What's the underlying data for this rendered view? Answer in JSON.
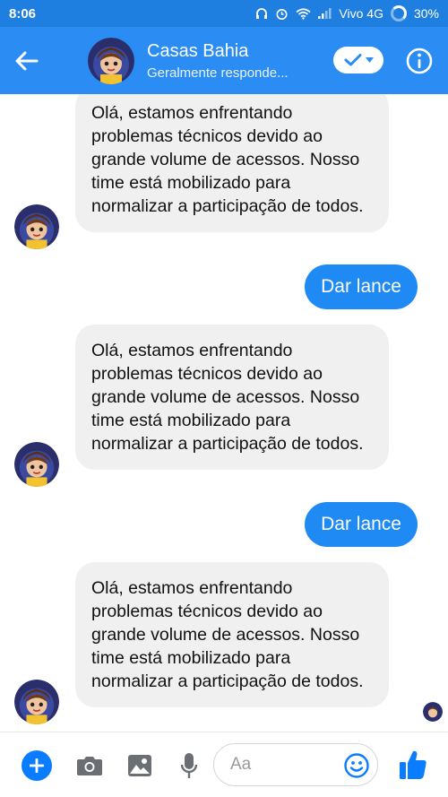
{
  "status_bar": {
    "time": "8:06",
    "carrier": "Vivo 4G",
    "battery": "30%"
  },
  "header": {
    "title": "Casas Bahia",
    "subtitle": "Geralmente responde..."
  },
  "messages": [
    {
      "from": "page",
      "text": "Olá, estamos enfrentando problemas técnicos devido ao grande volume de acessos. Nosso time está mobilizado para normalizar a participação de todos."
    },
    {
      "from": "user",
      "text": "Dar lance"
    },
    {
      "from": "page",
      "text": "Olá, estamos enfrentando problemas técnicos devido ao grande volume de acessos. Nosso time está mobilizado para normalizar a participação de todos."
    },
    {
      "from": "user",
      "text": "Dar lance"
    },
    {
      "from": "page",
      "text": "Olá, estamos enfrentando problemas técnicos devido ao grande volume de acessos. Nosso time está mobilizado para normalizar a participação de todos."
    }
  ],
  "composer": {
    "placeholder": "Aa"
  },
  "colors": {
    "status_bar": "#1f7fe0",
    "app_bar": "#2b8cf4",
    "outgoing_bubble": "#1f8af3",
    "incoming_bubble": "#f1f0f0",
    "accent": "#0a7cff"
  }
}
